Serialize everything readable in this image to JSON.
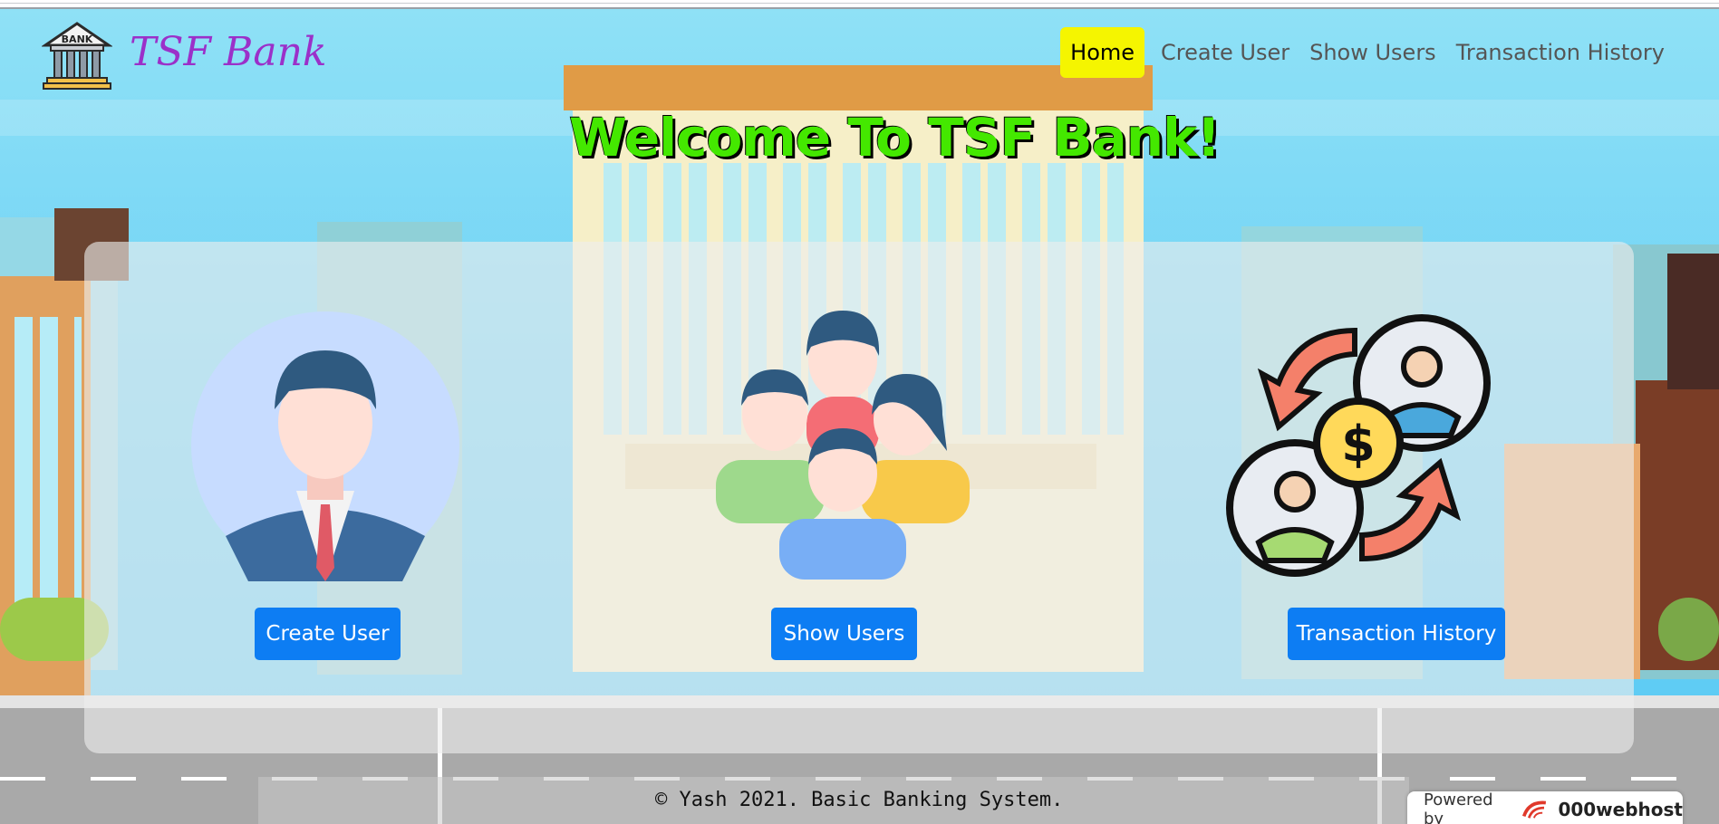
{
  "brand": {
    "name": "TSF Bank",
    "logo_text": "BANK"
  },
  "nav": {
    "items": [
      {
        "label": "Home",
        "active": true
      },
      {
        "label": "Create User",
        "active": false
      },
      {
        "label": "Show Users",
        "active": false
      },
      {
        "label": "Transaction History",
        "active": false
      }
    ]
  },
  "hero": {
    "title": "Welcome To TSF Bank!"
  },
  "cards": [
    {
      "button": "Create User",
      "icon": "businessman-avatar-icon"
    },
    {
      "button": "Show Users",
      "icon": "user-group-icon"
    },
    {
      "button": "Transaction History",
      "icon": "money-transfer-icon"
    }
  ],
  "footer": {
    "text": "© Yash 2021. Basic Banking System.",
    "powered_by": "Powered by",
    "host": "000webhost"
  },
  "colors": {
    "brand": "#9b30c9",
    "active_nav": "#f5f500",
    "button": "#0d7df3",
    "title": "#44e800"
  }
}
